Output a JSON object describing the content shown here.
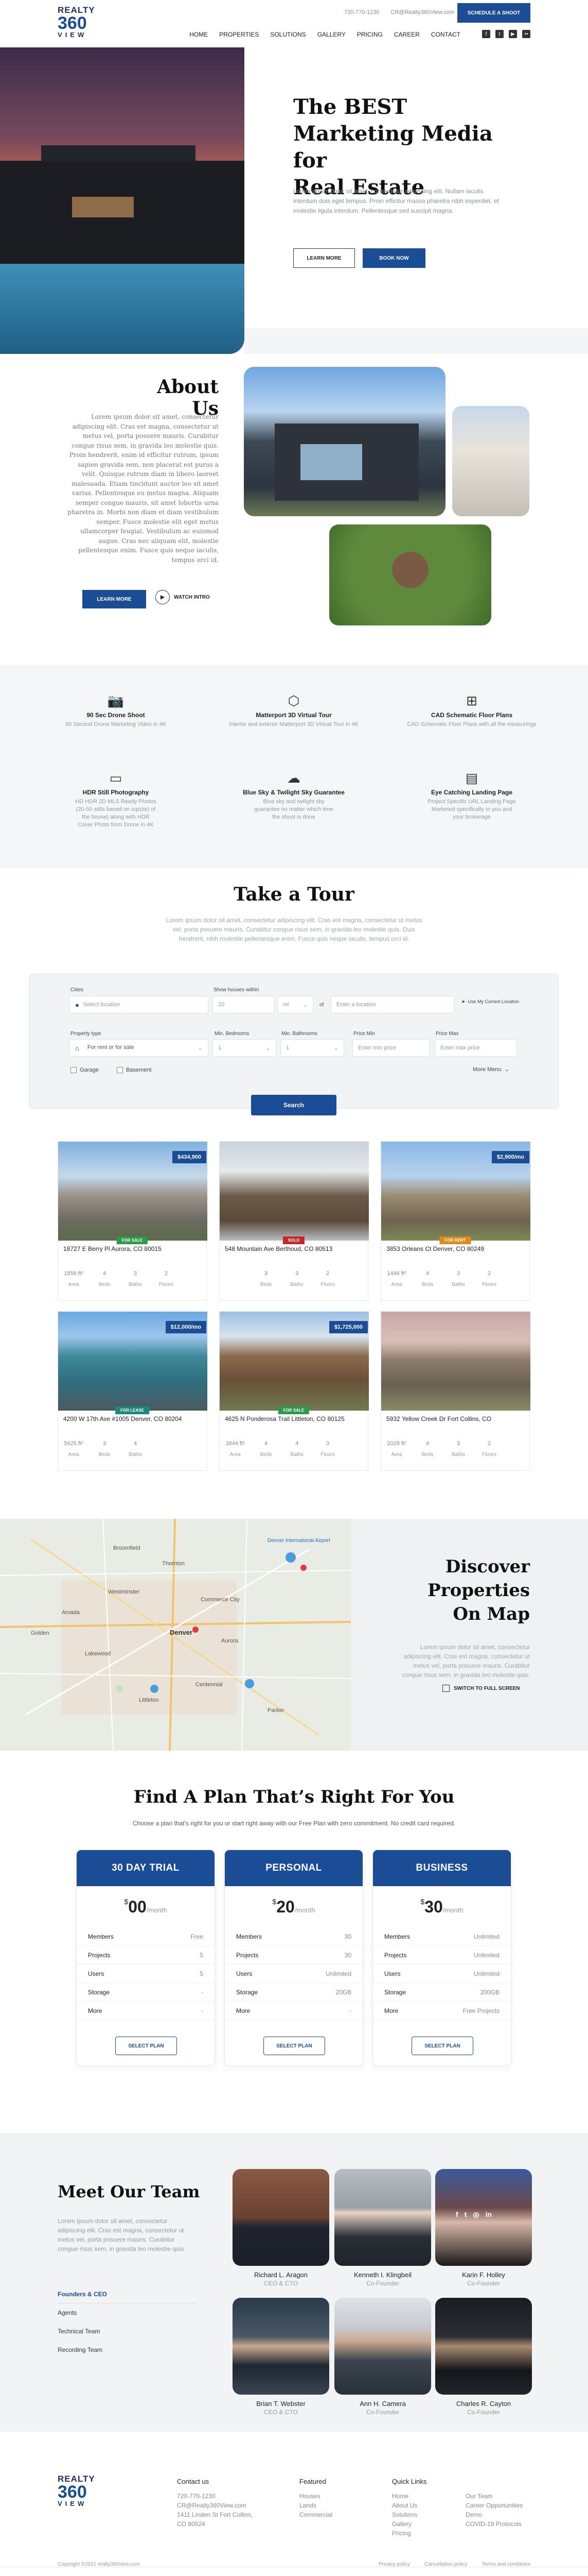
{
  "header": {
    "logo": {
      "line1": "REALTY",
      "line2": "360",
      "line3": "VIEW"
    },
    "phone": "720-770-1230",
    "email": "CR@Realty360View.com",
    "schedule_label": "SCHEDULE A SHOOT",
    "nav": [
      "HOME",
      "PROPERTIES",
      "SOLUTIONS",
      "GALLERY",
      "PRICING",
      "CAREER",
      "CONTACT"
    ],
    "social": [
      "facebook-icon",
      "twitter-icon",
      "youtube-icon",
      "flickr-icon"
    ]
  },
  "hero": {
    "title_line1": "The BEST",
    "title_line2": "Marketing Media for",
    "title_line3": "Real Estate",
    "text": "Lorem ipsum dolor sit amet, consectetur adipiscing elit. Nullam iaculis interdum duis eget tempus. Proin efficitur massa pharetra nibh imperdiet, et molestie ligula interdum. Pellentesque sed suscipit magna.",
    "learn_more": "LEARN MORE",
    "book_now": "BOOK NOW"
  },
  "about": {
    "title": "About Us",
    "text": "Lorem ipsum dolor sit amet, consectetur adipiscing elit. Cras est magna, consectetur ut metus vel, porta posuere mauris. Curabitur congue risus sem, in gravida leo molestie quis. Proin hendrerit, enim id efficitur rutrum, ipsum sapien gravida sem, non placerat est purus a velit. Quisque rutrum diam in libero laoreet malesuada. Etiam tincidunt auctor leo sit amet varius. Pellentesque eu metus magna. Aliquam semper congue mauris, sit amet lobortis urna pharetra in. Morbi non diam et diam vestibulum semper. Fusce molestie elit eget metus ullamcorper feugiat. Vestibulum ac euismod augue. Cras nec aliquam elit, molestie pellentesque enim. Fusce quis neque iaculis, tempus orci id.",
    "learn_more": "LEARN MORE",
    "watch_intro": "WATCH INTRO"
  },
  "features": [
    {
      "icon": "camera-icon",
      "glyph": "📷",
      "title": "90 Sec Drone Shoot",
      "desc": "90 Second Drone Marketing Video in 4K"
    },
    {
      "icon": "cube-icon",
      "glyph": "⬡",
      "title": "Matterport 3D Virtual Tour",
      "desc": "Interior and exterior Matterport 3D Virtual Tour in 4K"
    },
    {
      "icon": "floorplan-icon",
      "glyph": "⊞",
      "title": "CAD Schematic Floor Plans",
      "desc": "CAD Schematic Floor Plans with all the measurings"
    },
    {
      "icon": "photo-icon",
      "glyph": "▭",
      "title": "HDR Still Photography",
      "desc": "HD HDR 2D MLS Ready Photos (20-50 stills based on sqsize) of the house) along with HDR Cover Photo from Drone in 4K"
    },
    {
      "icon": "weather-icon",
      "glyph": "☁",
      "title": "Blue Sky & Twilight Sky Guarantee",
      "desc": "Blue sky and twilight sky guarantee no matter which time the shoot is done"
    },
    {
      "icon": "landing-page-icon",
      "glyph": "▤",
      "title": "Eye Catching Landing Page",
      "desc": "Project Specific URL Landing Page Marketed specifically to you and your brokerage"
    }
  ],
  "tour": {
    "title": "Take a Tour",
    "sub": "Lorem ipsum dolor sit amet, consectetur adipiscing elit. Cras est magna, consectetur ut metus vel, porta posuere mauris. Curabitur congue risus sem, in gravida leo molestie quis. Duis hendrerit, nibh molestie pellentesque enim. Fusce quis neque iaculis, tempus orci id.",
    "search": {
      "cities_label": "Cities",
      "cities_placeholder": "Select location",
      "within_label": "Show houses within",
      "within_value": "20",
      "unit_value": "mi",
      "of_label": "of",
      "location_placeholder": "Enter a location",
      "use_location": "Use My Current Location",
      "type_label": "Property type",
      "type_value": "For rent or for sale",
      "bedrooms_label": "Min. Bedrooms",
      "bedrooms_value": "1",
      "bathrooms_label": "Min. Bathrooms",
      "bathrooms_value": "1",
      "price_min_label": "Price Min",
      "price_min_placeholder": "Enter min price",
      "price_max_label": "Price Max",
      "price_max_placeholder": "Enter max price",
      "garage": "Garage",
      "basement": "Basement",
      "more_menu": "More Menu",
      "search_label": "Search"
    },
    "listings": [
      {
        "price": "$434,900",
        "tag": "FOR SALE",
        "tag_color": "#2e9a4a",
        "address": "18727 E Berry Pl Aurora, CO 80015",
        "area": "1856 ft²",
        "beds": "4",
        "baths": "3",
        "floors": "2"
      },
      {
        "price": "",
        "tag": "SOLD",
        "tag_color": "#c62828",
        "address": "548 Mountain Ave Berthoud, CO 80513",
        "area": "",
        "beds": "3",
        "baths": "3",
        "floors": "2"
      },
      {
        "price": "$2,900/mo",
        "tag": "FOR RENT",
        "tag_color": "#e08a1a",
        "address": "3853 Orleans Ct Denver, CO 80249",
        "area": "1446 ft²",
        "beds": "4",
        "baths": "3",
        "floors": "2"
      },
      {
        "price": "$12,000/mo",
        "tag": "FOR LEASE",
        "tag_color": "#1a8a7a",
        "address": "4200 W 17th Ave #1005 Denver, CO 80204",
        "area": "5625 ft²",
        "beds": "3",
        "baths": "4",
        "floors": ""
      },
      {
        "price": "$1,725,000",
        "tag": "FOR SALE",
        "tag_color": "#2e9a4a",
        "address": "4625 N Ponderosa Trail Littleton, CO 80125",
        "area": "3844 ft²",
        "beds": "4",
        "baths": "4",
        "floors": "3"
      },
      {
        "price": "",
        "tag": "",
        "tag_color": "",
        "address": "5932 Yellow Creek Dr Fort Collins, CO",
        "area": "2029 ft²",
        "beds": "4",
        "baths": "3",
        "floors": "2"
      }
    ],
    "stat_labels": {
      "area": "Area",
      "beds": "Beds",
      "baths": "Baths",
      "floors": "Floors"
    }
  },
  "map": {
    "title_line1": "Discover",
    "title_line2": "Properties",
    "title_line3": "On Map",
    "text": "Lorem ipsum dolor sit amet, consectetur adipiscing elit. Cras est magna, consectetur ut metus vel, porta posuere mauris. Curabitur congue risus sem, in gravida leo molestie quis.",
    "switch_label": "SWITCH TO FULL SCREEN",
    "places": [
      "Thornton",
      "Westminster",
      "Arvada",
      "Denver",
      "Aurora",
      "Lakewood",
      "Littleton",
      "Centennial",
      "Parker",
      "Golden",
      "Broomfield",
      "Commerce City",
      "Denver International Airport"
    ]
  },
  "plans": {
    "title": "Find A Plan That’s Right For You",
    "sub": "Choose a plan that's right for you or start right away with our Free Plan with zero commitment. No credit card required.",
    "row_labels": [
      "Members",
      "Projects",
      "Users",
      "Storage",
      "More"
    ],
    "currency": "$",
    "per": "/month",
    "select": "SELECT PLAN",
    "items": [
      {
        "name": "30 DAY TRIAL",
        "price": "00",
        "values": [
          "Free",
          "5",
          "5",
          "-",
          "-"
        ]
      },
      {
        "name": "PERSONAL",
        "price": "20",
        "values": [
          "30",
          "30",
          "Unlimited",
          "20GB",
          "-"
        ]
      },
      {
        "name": "BUSINESS",
        "price": "30",
        "values": [
          "Unlimited",
          "Unlimited",
          "Unlimited",
          "200GB",
          "Free Projects"
        ]
      }
    ]
  },
  "team": {
    "title": "Meet Our Team",
    "text": "Lorem ipsum dolor sit amet, consectetur adipiscing elit. Cras est magna, consectetur ut metus vel, porta posuere mauris. Curabitur congue risus sem, in gravida leo molestie quis.",
    "menu": [
      "Founders & CEO",
      "Agents",
      "Technical Team",
      "Recording Team"
    ],
    "members": [
      {
        "name": "Richard L. Aragon",
        "role": "CEO & CTO",
        "tone": "#5a3a2e"
      },
      {
        "name": "Kenneth I. Klingbeil",
        "role": "Co-Founder",
        "tone": "#7a7f86"
      },
      {
        "name": "Karin F. Holley",
        "role": "Co-Founder",
        "tone": "#6a4a4a"
      },
      {
        "name": "Brian T. Webster",
        "role": "CEO & CTO",
        "tone": "#3a4550"
      },
      {
        "name": "Ann H. Camera",
        "role": "Co-Founder",
        "tone": "#5a6470"
      },
      {
        "name": "Charles R. Cayton",
        "role": "Co-Founder",
        "tone": "#2e3238"
      }
    ]
  },
  "footer": {
    "contact_title": "Contact us",
    "contact": [
      "720-770-1230",
      "CR@Realty360View.com",
      "1411 Linden St Fort Collins,",
      "CO 80524"
    ],
    "featured_title": "Featured",
    "featured": [
      "Houses",
      "Lands",
      "Commercial"
    ],
    "quick_title": "Quick Links",
    "quick1": [
      "Home",
      "About Us",
      "Solutions",
      "Gallery",
      "Pricing"
    ],
    "quick2": [
      "Our Team",
      "Career Opportunities",
      "Demo",
      "COVID-19 Protocols"
    ],
    "copyright": "Copyright ©2021 realty360view.com",
    "bottom_links": [
      "Privacy policy",
      "Cancellation policy",
      "Terms and conditions"
    ]
  }
}
